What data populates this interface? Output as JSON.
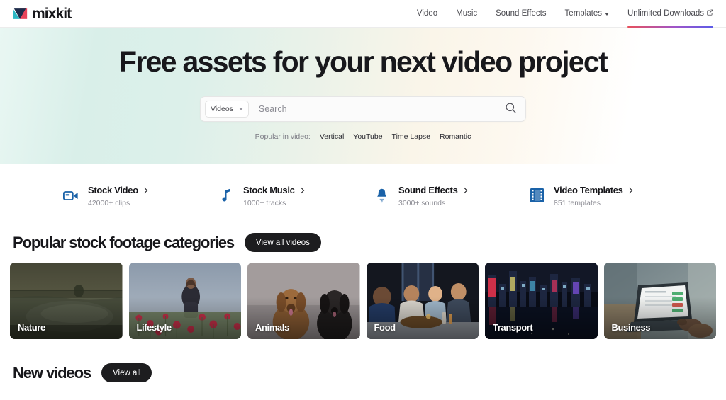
{
  "header": {
    "logo_text": "mixkit",
    "logo_icon": "mixkit-logo-mark",
    "nav": [
      {
        "label": "Video",
        "icon": null,
        "accent": false
      },
      {
        "label": "Music",
        "icon": null,
        "accent": false
      },
      {
        "label": "Sound Effects",
        "icon": null,
        "accent": false
      },
      {
        "label": "Templates",
        "icon": "chevron-down-icon",
        "accent": false
      },
      {
        "label": "Unlimited Downloads",
        "icon": "external-link-icon",
        "accent": true
      }
    ]
  },
  "hero": {
    "title": "Free assets for your next video project",
    "search": {
      "filter_value": "Videos",
      "filter_icon": "chevron-down-icon",
      "placeholder": "Search",
      "value": "",
      "submit_icon": "search-icon"
    },
    "popular": {
      "label": "Popular in video:",
      "links": [
        "Vertical",
        "YouTube",
        "Time Lapse",
        "Romantic"
      ]
    }
  },
  "shortcuts": [
    {
      "icon": "video-camera-icon",
      "title": "Stock Video",
      "chevron": "chevron-right-icon",
      "subtitle": "42000+ clips"
    },
    {
      "icon": "music-note-icon",
      "title": "Stock Music",
      "chevron": "chevron-right-icon",
      "subtitle": "1000+ tracks"
    },
    {
      "icon": "bell-icon",
      "title": "Sound Effects",
      "chevron": "chevron-right-icon",
      "subtitle": "3000+ sounds"
    },
    {
      "icon": "film-strip-icon",
      "title": "Video Templates",
      "chevron": "chevron-right-icon",
      "subtitle": "851 templates"
    }
  ],
  "categories_section": {
    "title": "Popular stock footage categories",
    "view_all_label": "View all videos",
    "cards": [
      {
        "label": "Nature"
      },
      {
        "label": "Lifestyle"
      },
      {
        "label": "Animals"
      },
      {
        "label": "Food"
      },
      {
        "label": "Transport"
      },
      {
        "label": "Business"
      }
    ]
  },
  "new_videos_section": {
    "title": "New videos",
    "view_all_label": "View all"
  },
  "colors": {
    "accent_blue": "#1a62a8",
    "logo_teal": "#2bb7c4",
    "logo_red": "#e8435a",
    "underline_from": "#e8505b",
    "underline_to": "#5b5be8",
    "pill_bg": "#1d1d1f"
  }
}
